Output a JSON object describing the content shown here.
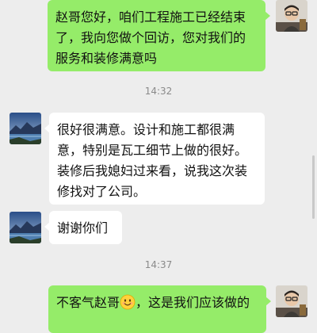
{
  "conversation": {
    "messages": [
      {
        "sender": "self",
        "text": "赵哥您好，咱们工程施工已经结束了，我向您做个回访，您对我们的服务和装修满意吗"
      },
      {
        "type": "timestamp",
        "text": "14:32"
      },
      {
        "sender": "other",
        "text": "很好很满意。设计和施工都很满意，特别是瓦工细节上做的很好。装修后我媳妇过来看，说我这次装修找对了公司。"
      },
      {
        "sender": "other",
        "text": "谢谢你们"
      },
      {
        "type": "timestamp",
        "text": "14:37"
      },
      {
        "sender": "self",
        "text_before_emoji": "不客气赵哥",
        "emoji": "smile-emoji",
        "text_after_emoji": "，这是我们应该做的"
      }
    ]
  },
  "avatars": {
    "self": "person-with-glasses-avatar",
    "other": "landscape-avatar"
  },
  "colors": {
    "background": "#ededed",
    "self_bubble": "#95ec69",
    "other_bubble": "#ffffff",
    "timestamp_text": "#8a8a8a"
  }
}
